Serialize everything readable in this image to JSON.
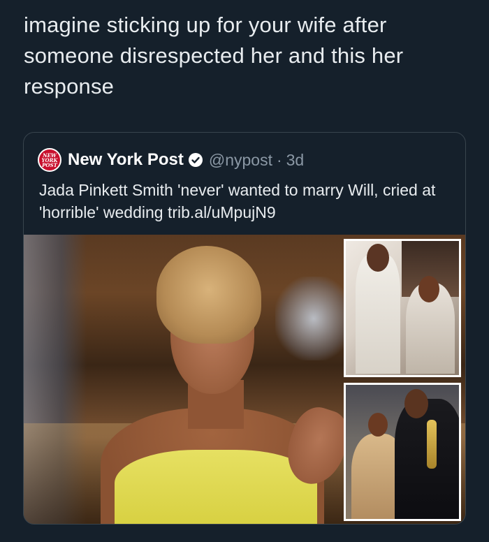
{
  "tweet": {
    "text": "imagine sticking up for your wife after someone disrespected her and this her response"
  },
  "quoted_tweet": {
    "logo_lines": [
      "NEW",
      "YORK",
      "POST"
    ],
    "author_name": "New York Post",
    "handle": "@nypost",
    "separator": "·",
    "time": "3d",
    "body": "Jada Pinkett Smith 'never' wanted to marry Will, cried at 'horrible' wedding trib.al/uMpujN9",
    "colors": {
      "logo_red": "#c8102e",
      "verified_blue": "#1d9bf0",
      "background": "#15202b",
      "border": "#38444d",
      "secondary_text": "#8b98a5"
    },
    "media": {
      "main_photo_icon": "interview-photo",
      "inset_photos": [
        "wedding-photo",
        "oscars-photo"
      ]
    }
  }
}
